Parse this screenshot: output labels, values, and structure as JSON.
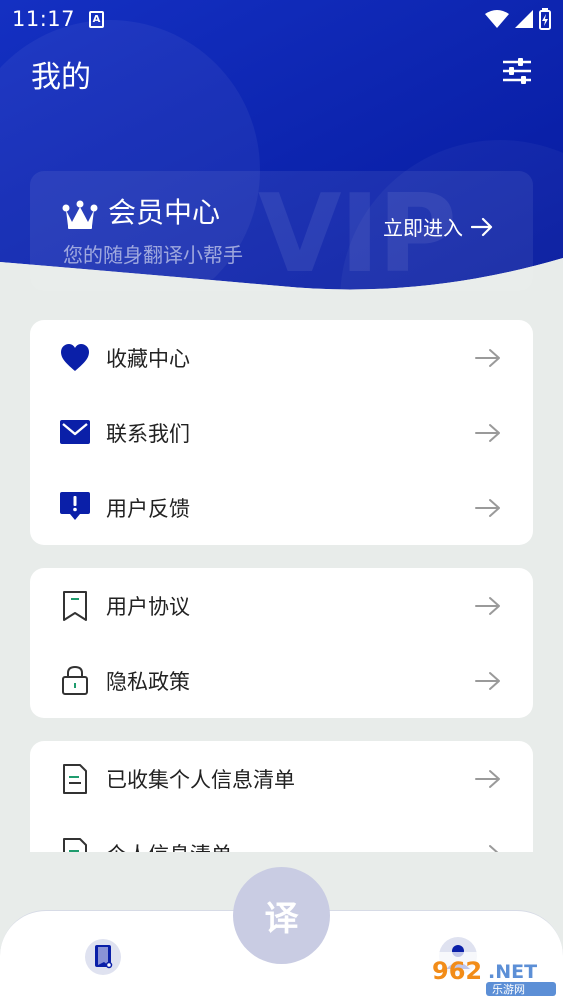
{
  "status_bar": {
    "time": "11:17",
    "a_badge": "A"
  },
  "header": {
    "title": "我的"
  },
  "vip": {
    "watermark": "VIP",
    "title": "会员中心",
    "subtitle": "您的随身翻译小帮手",
    "enter_label": "立即进入"
  },
  "menu": {
    "group1": [
      {
        "label": "收藏中心",
        "icon": "heart-icon"
      },
      {
        "label": "联系我们",
        "icon": "mail-icon"
      },
      {
        "label": "用户反馈",
        "icon": "feedback-icon"
      }
    ],
    "group2": [
      {
        "label": "用户协议",
        "icon": "bookmark-icon"
      },
      {
        "label": "隐私政策",
        "icon": "lock-icon"
      }
    ],
    "group3": [
      {
        "label": "已收集个人信息清单",
        "icon": "document-icon"
      },
      {
        "label": "个人信息清单",
        "icon": "document-icon"
      }
    ]
  },
  "bottom_nav": {
    "fab_label": "译"
  },
  "colors": {
    "brand_blue": "#0a1fa8",
    "fab": "#c9cce3"
  }
}
